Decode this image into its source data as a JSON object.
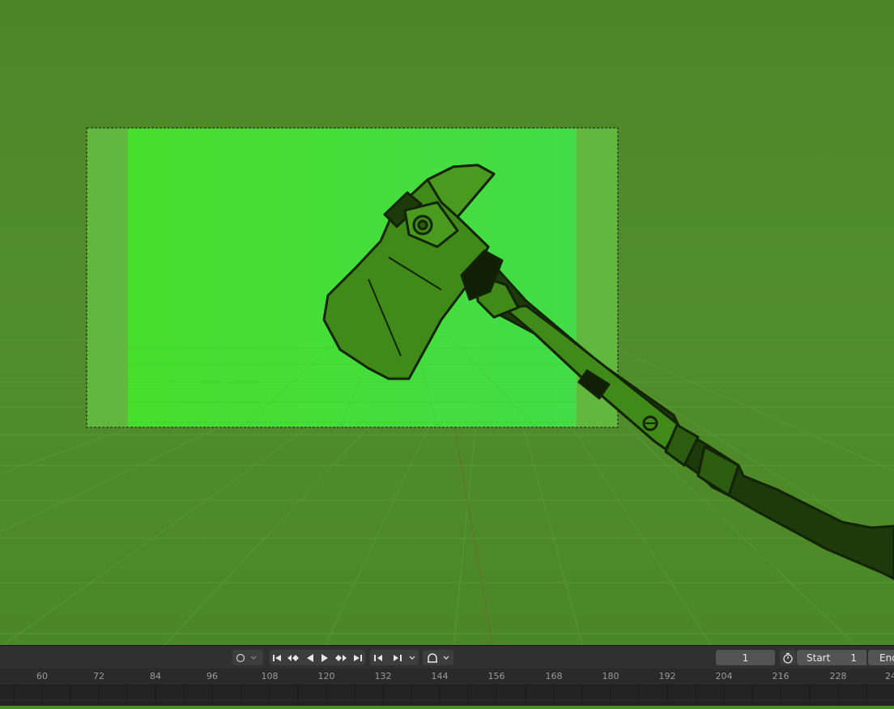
{
  "viewport": {
    "background": "#4f8a2b",
    "camera_frame_fill": "#49e02f",
    "axe_body_color": "#3f8a18",
    "axe_outline_color": "#132405"
  },
  "playback": {
    "keyframe_toggle_icon": "circle-icon",
    "jump_start_icon": "jump-to-start-icon",
    "prev_keyframe_icon": "prev-keyframe-icon",
    "play_reverse_icon": "play-reverse-icon",
    "play_icon": "play-icon",
    "next_keyframe_icon": "next-keyframe-icon",
    "jump_end_icon": "jump-to-end-icon",
    "step_back_icon": "step-back-icon",
    "step_forward_icon": "step-forward-icon",
    "snap_icon": "magnet-snap-icon",
    "current_frame": "1",
    "start_label": "Start",
    "start_value": "1",
    "end_label": "End"
  },
  "ruler": {
    "ticks": [
      "60",
      "72",
      "84",
      "96",
      "108",
      "120",
      "132",
      "144",
      "156",
      "168",
      "180",
      "192",
      "204",
      "216",
      "228",
      "24"
    ]
  }
}
